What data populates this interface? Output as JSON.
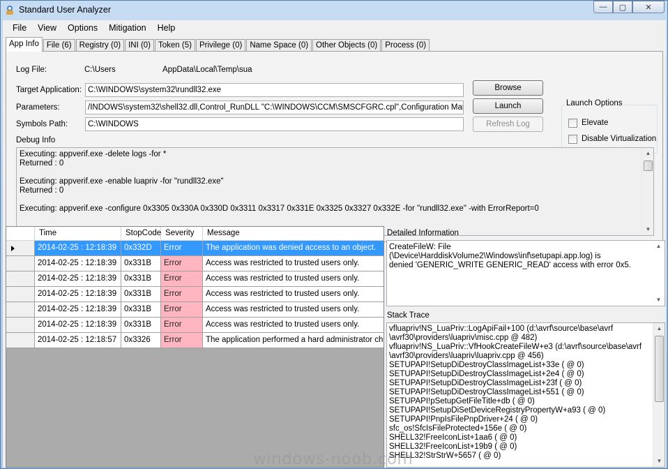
{
  "window": {
    "title": "Standard User Analyzer",
    "controls": {
      "minimize": "—",
      "maximize": "▢",
      "close": "✕"
    }
  },
  "menu": [
    "File",
    "View",
    "Options",
    "Mitigation",
    "Help"
  ],
  "tabs": [
    "App Info",
    "File (6)",
    "Registry (0)",
    "INI (0)",
    "Token (5)",
    "Privilege (0)",
    "Name Space (0)",
    "Other Objects (0)",
    "Process (0)"
  ],
  "app_info": {
    "log_file_label": "Log File:",
    "log_file_prefix": "C:\\Users",
    "log_file_suffix": "AppData\\Local\\Temp\\sua",
    "target_label": "Target Application:",
    "target_value": "C:\\WINDOWS\\system32\\rundll32.exe",
    "params_label": "Parameters:",
    "params_value": "/INDOWS\\system32\\shell32.dll,Control_RunDLL \"C:\\WINDOWS\\CCM\\SMSCFGRC.cpl\",Configuration Manager",
    "symbols_label": "Symbols Path:",
    "symbols_value": "C:\\WINDOWS",
    "browse_label": "Browse",
    "launch_label": "Launch",
    "refresh_label": "Refresh Log",
    "launch_options_title": "Launch Options",
    "elevate_label": "Elevate",
    "disable_virt_label": "Disable Virtualization",
    "debug_title": "Debug Info",
    "debug_lines": [
      "Executing: appverif.exe -delete logs -for *",
      "Returned : 0",
      "",
      "Executing: appverif.exe -enable luapriv -for \"rundll32.exe\"",
      "Returned : 0",
      "",
      "Executing: appverif.exe -configure 0x3305 0x330A 0x330D 0x3311 0x3317 0x331E 0x3325 0x3327 0x332E -for \"rundll32.exe\" -with ErrorReport=0"
    ]
  },
  "grid": {
    "columns": [
      "Time",
      "StopCode",
      "Severity",
      "Message"
    ],
    "rows": [
      {
        "time": "2014-02-25 : 12:18:39",
        "code": "0x332D",
        "severity": "Error",
        "message": "The application was denied access to an object."
      },
      {
        "time": "2014-02-25 : 12:18:39",
        "code": "0x331B",
        "severity": "Error",
        "message": "Access was restricted to trusted users only."
      },
      {
        "time": "2014-02-25 : 12:18:39",
        "code": "0x331B",
        "severity": "Error",
        "message": "Access was restricted to trusted users only."
      },
      {
        "time": "2014-02-25 : 12:18:39",
        "code": "0x331B",
        "severity": "Error",
        "message": "Access was restricted to trusted users only."
      },
      {
        "time": "2014-02-25 : 12:18:39",
        "code": "0x331B",
        "severity": "Error",
        "message": "Access was restricted to trusted users only."
      },
      {
        "time": "2014-02-25 : 12:18:39",
        "code": "0x331B",
        "severity": "Error",
        "message": "Access was restricted to trusted users only."
      },
      {
        "time": "2014-02-25 : 12:18:57",
        "code": "0x3326",
        "severity": "Error",
        "message": "The application performed a hard administrator che..."
      }
    ]
  },
  "detail": {
    "title": "Detailed Information",
    "lines": [
      "CreateFileW: File (\\Device\\HarddiskVolume2\\Windows\\inf\\setupapi.app.log) is",
      "denied 'GENERIC_WRITE GENERIC_READ' access with error 0x5."
    ]
  },
  "stack": {
    "title": "Stack Trace",
    "lines": [
      "vfluapriv!NS_LuaPriv::LogApiFail+100 (d:\\avrf\\source\\base\\avrf",
      "\\avrf30\\providers\\luapriv\\misc.cpp @ 482)",
      "vfluapriv!NS_LuaPriv::VfHookCreateFileW+e3 (d:\\avrf\\source\\base\\avrf",
      "\\avrf30\\providers\\luapriv\\luapriv.cpp @ 456)",
      "SETUPAPI!SetupDiDestroyClassImageList+33e ( @ 0)",
      "SETUPAPI!SetupDiDestroyClassImageList+2e4 ( @ 0)",
      "SETUPAPI!SetupDiDestroyClassImageList+23f ( @ 0)",
      "SETUPAPI!SetupDiDestroyClassImageList+551 ( @ 0)",
      "SETUPAPI!pSetupGetFileTitle+db ( @ 0)",
      "SETUPAPI!SetupDiSetDeviceRegistryPropertyW+a93 ( @ 0)",
      "SETUPAPI!PnpIsFilePnpDriver+24 ( @ 0)",
      "sfc_os!SfcIsFileProtected+156e ( @ 0)",
      "SHELL32!FreeIconList+1aa6 ( @ 0)",
      "SHELL32!FreeIconList+19b9 ( @ 0)",
      "SHELL32!StrStrW+5657 ( @ 0)"
    ]
  },
  "watermark": "windows-noob.com",
  "colors": {
    "selection": "#3399ff",
    "error_cell": "#ffb6c1",
    "frame": "#b9d1ea"
  }
}
